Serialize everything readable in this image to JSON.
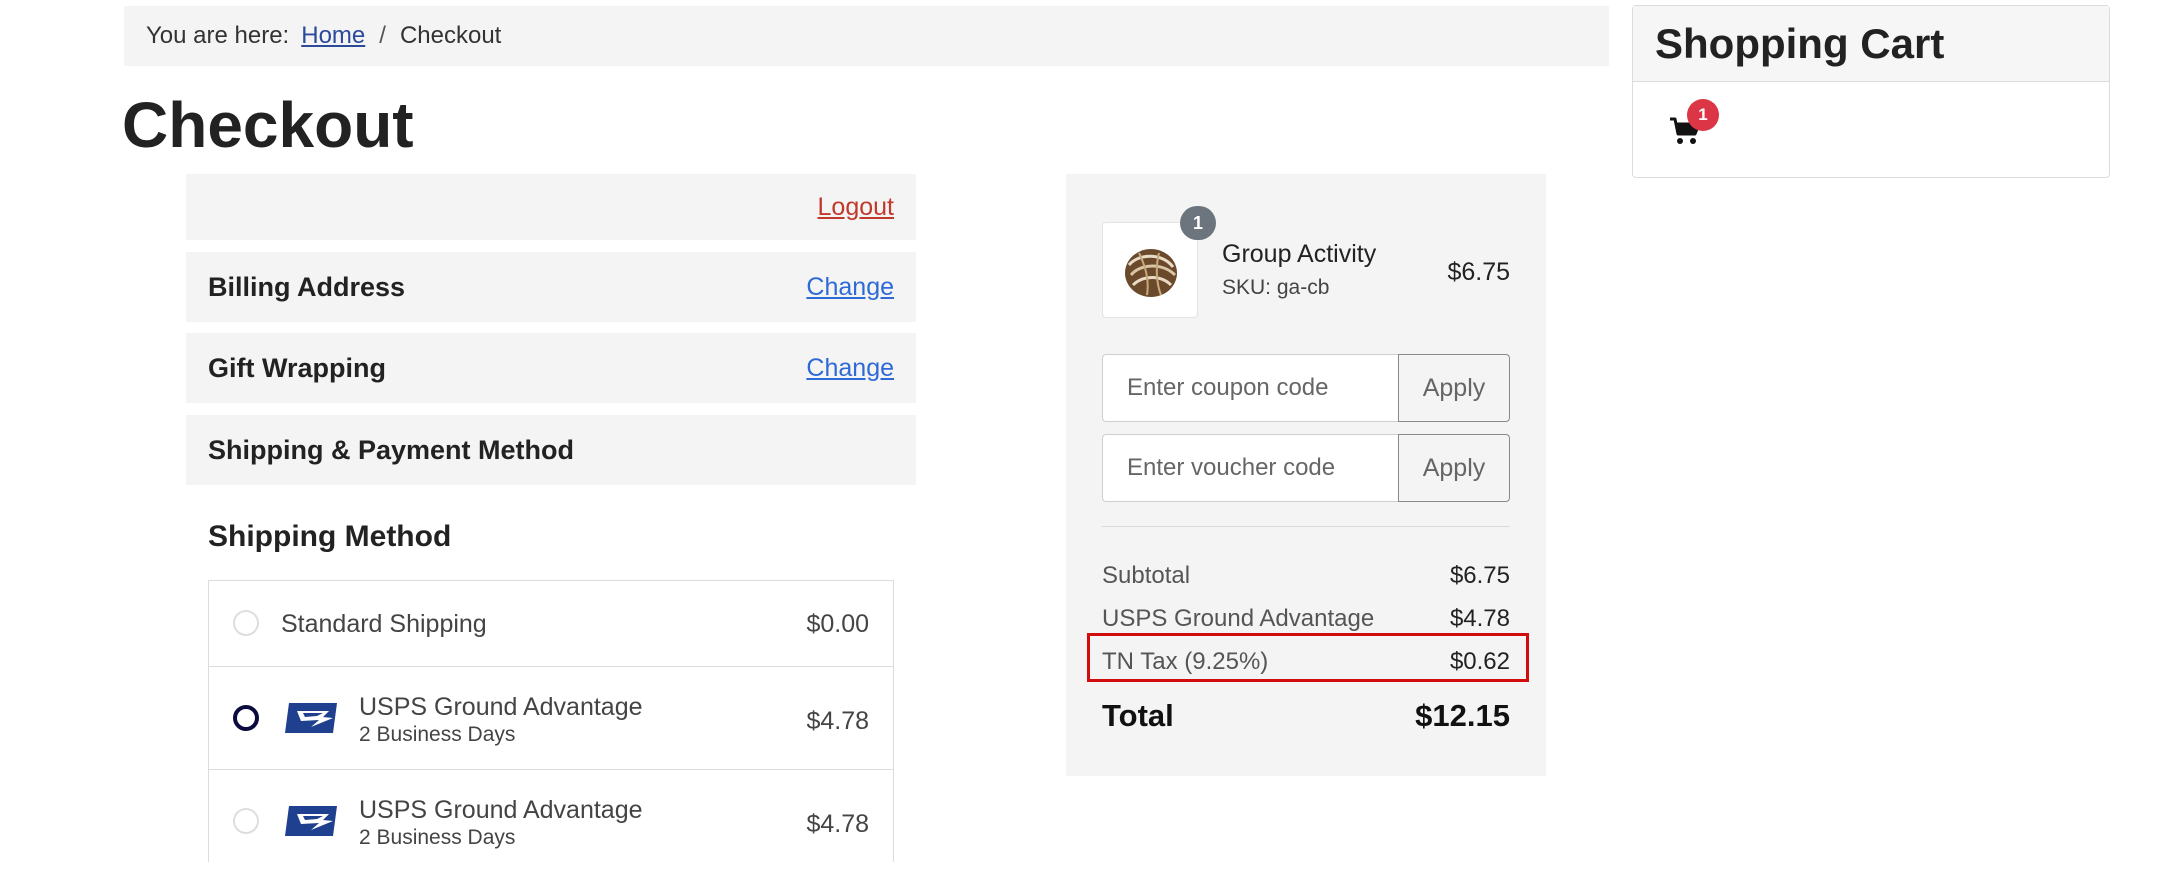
{
  "breadcrumb": {
    "prefix": "You are here:",
    "home": "Home",
    "separator": "/",
    "current": "Checkout"
  },
  "page_title": "Checkout",
  "steps": {
    "logout": "Logout",
    "billing": {
      "title": "Billing Address",
      "action": "Change"
    },
    "gift": {
      "title": "Gift Wrapping",
      "action": "Change"
    },
    "shipping_payment": {
      "title": "Shipping & Payment Method"
    }
  },
  "shipping": {
    "heading": "Shipping Method",
    "options": [
      {
        "name": "Standard Shipping",
        "sub": "",
        "price": "$0.00",
        "selected": false,
        "icon": "none"
      },
      {
        "name": "USPS Ground Advantage",
        "sub": "2 Business Days",
        "price": "$4.78",
        "selected": true,
        "icon": "usps-eagle-icon"
      },
      {
        "name": "USPS Ground Advantage",
        "sub": "2 Business Days",
        "price": "$4.78",
        "selected": false,
        "icon": "usps-eagle-icon"
      }
    ]
  },
  "summary": {
    "product": {
      "quantity": "1",
      "name": "Group Activity",
      "sku": "SKU: ga-cb",
      "price": "$6.75"
    },
    "coupon": {
      "placeholder": "Enter coupon code",
      "button": "Apply"
    },
    "voucher": {
      "placeholder": "Enter voucher code",
      "button": "Apply"
    },
    "subtotal": {
      "label": "Subtotal",
      "value": "$6.75"
    },
    "shipping": {
      "label": "USPS Ground Advantage",
      "value": "$4.78"
    },
    "tax": {
      "label": "TN Tax (9.25%)",
      "value": "$0.62"
    },
    "total": {
      "label": "Total",
      "value": "$12.15"
    }
  },
  "cart": {
    "title": "Shopping Cart",
    "count": "1"
  },
  "colors": {
    "highlight": "#d10c0c",
    "badge": "#dc3545",
    "link": "#2d6ad6",
    "logout": "#c0392b"
  }
}
